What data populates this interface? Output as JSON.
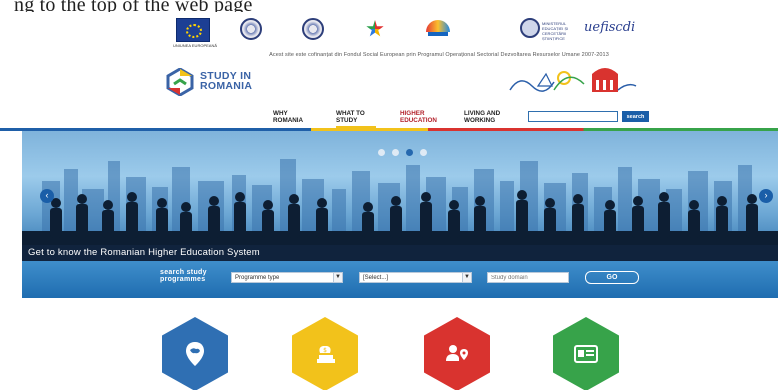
{
  "top_caption": "ng to the top of the web page",
  "logos": {
    "eu_caption": "UNIUNEA EUROPEANĂ",
    "fiscdi": "uefiscdi",
    "ministry_text": "MINISTERUL EDUCAȚIEI ȘI CERCETĂRII ȘTIINȚIFICE"
  },
  "funding_line": "Acest site este cofinanțat din Fondul Social European prin Programul Operațional Sectorial Dezvoltarea Resurselor Umane 2007-2013",
  "brand": {
    "line1": "STUDY IN",
    "line2": "ROMANIA"
  },
  "nav": {
    "items": [
      {
        "line1": "WHY",
        "line2": "ROMANIA"
      },
      {
        "line1": "WHAT TO",
        "line2": "STUDY"
      },
      {
        "line1": "HIGHER",
        "line2": "EDUCATION"
      },
      {
        "line1": "LIVING AND",
        "line2": "WORKING"
      }
    ],
    "search_placeholder": "",
    "search_label": "search"
  },
  "hero": {
    "caption": "Get to know the Romanian Higher Education System",
    "prev": "‹",
    "next": "›"
  },
  "search_programmes": {
    "label_line1": "search study",
    "label_line2": "programmes",
    "programme_type": "Programme type",
    "select_default": "[Select...]",
    "domain_placeholder": "Study domain",
    "go_label": "GO"
  },
  "colors": {
    "brand_blue": "#1f5fa8",
    "yellow": "#f2c21b",
    "red": "#d9332f",
    "green": "#37a34a"
  },
  "tiles": [
    {
      "icon": "map-pin-icon"
    },
    {
      "icon": "money-bag-icon"
    },
    {
      "icon": "person-location-icon"
    },
    {
      "icon": "id-card-icon"
    }
  ]
}
